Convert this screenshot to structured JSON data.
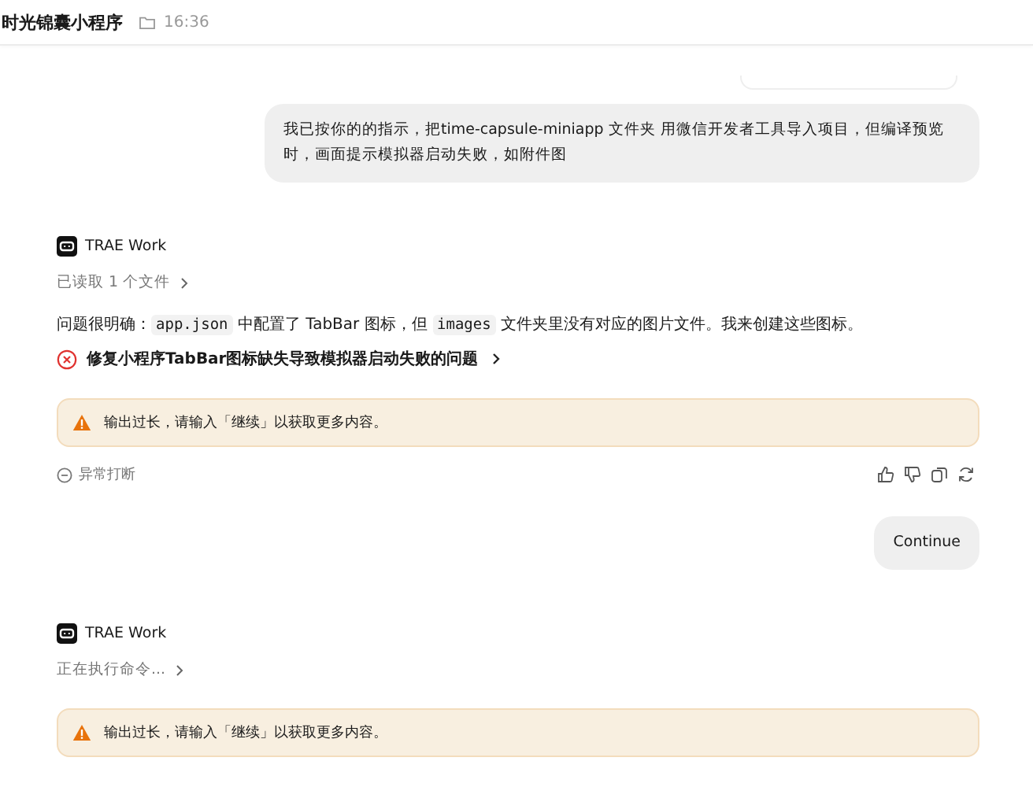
{
  "header": {
    "title": "时光锦囊小程序",
    "time": "16:36"
  },
  "messages": [
    {
      "kind": "user",
      "text": "我已按你的的指示，把time-capsule-miniapp 文件夹 用微信开发者工具导入项目，但编译预览时，画面提示模拟器启动失败，如附件图"
    },
    {
      "kind": "agent",
      "name": "TRAE Work",
      "status": "已读取 1 个文件",
      "body": [
        {
          "kind": "text",
          "text": "问题很明确："
        },
        {
          "kind": "code",
          "text": "app.json"
        },
        {
          "kind": "text",
          "text": " 中配置了 TabBar 图标，但 "
        },
        {
          "kind": "code",
          "text": "images"
        },
        {
          "kind": "text",
          "text": " 文件夹里没有对应的图片文件。我来创建这些图标。"
        }
      ],
      "task": "修复小程序TabBar图标缺失导致模拟器启动失败的问题",
      "warning": "输出过长，请输入「继续」以获取更多内容。",
      "interrupted": "异常打断"
    },
    {
      "kind": "user",
      "text": "Continue"
    },
    {
      "kind": "agent",
      "name": "TRAE Work",
      "status": "正在执行命令...",
      "warning": "输出过长，请输入「继续」以获取更多内容。"
    }
  ]
}
